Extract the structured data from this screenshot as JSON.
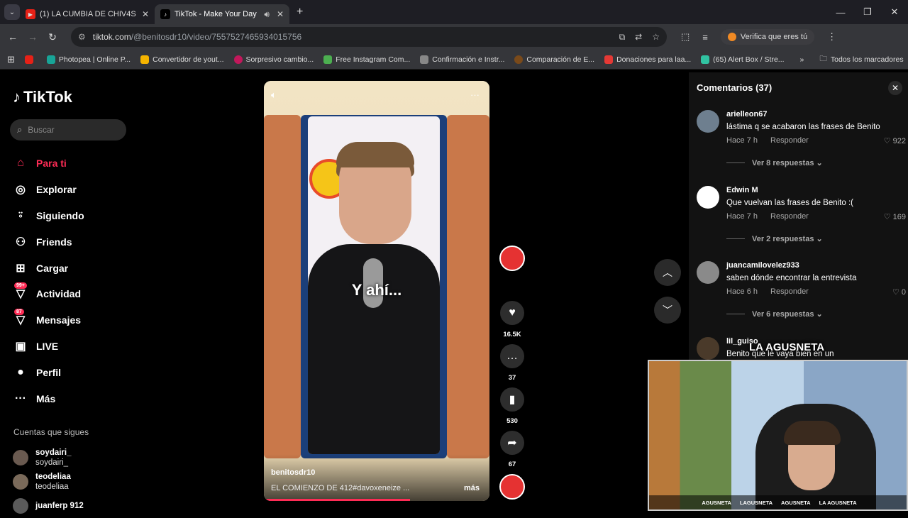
{
  "browser": {
    "tabs": [
      {
        "title": "(1) LA CUMBIA DE CHIV4S - Mi",
        "icon": "youtube-icon",
        "active": false
      },
      {
        "title": "TikTok - Make Your Day",
        "icon": "tiktok-icon",
        "active": true
      }
    ],
    "url_host": "tiktok.com",
    "url_path": "/@benitosdr10/video/7557527465934015756",
    "verify_label": "Verifica que eres tú",
    "bookmarks": [
      {
        "label": "",
        "color": "#e62117"
      },
      {
        "label": "Photopea | Online P...",
        "color": "#18a497"
      },
      {
        "label": "Convertidor de yout...",
        "color": "#f5b400"
      },
      {
        "label": "Sorpresivo cambio...",
        "color": "#c2185b"
      },
      {
        "label": "Free Instagram Com...",
        "color": "#4caf50"
      },
      {
        "label": "Confirmación e Instr...",
        "color": "#888888"
      },
      {
        "label": "Comparación de E...",
        "color": "#7a4a1a"
      },
      {
        "label": "Donaciones para laa...",
        "color": "#e53935"
      },
      {
        "label": "(65) Alert Box / Stre...",
        "color": "#31c3a2"
      }
    ],
    "all_bookmarks": "Todos los marcadores"
  },
  "sidebar": {
    "logo": "TikTok",
    "search_placeholder": "Buscar",
    "nav": [
      {
        "label": "Para ti",
        "icon": "home-icon",
        "active": true
      },
      {
        "label": "Explorar",
        "icon": "compass-icon"
      },
      {
        "label": "Siguiendo",
        "icon": "following-icon"
      },
      {
        "label": "Friends",
        "icon": "friends-icon"
      },
      {
        "label": "Cargar",
        "icon": "upload-icon"
      },
      {
        "label": "Actividad",
        "icon": "activity-icon",
        "badge": "99+"
      },
      {
        "label": "Mensajes",
        "icon": "messages-icon",
        "badge": "87"
      },
      {
        "label": "LIVE",
        "icon": "live-icon"
      },
      {
        "label": "Perfil",
        "icon": "profile-icon"
      },
      {
        "label": "Más",
        "icon": "more-icon"
      }
    ],
    "following_header": "Cuentas que sigues",
    "following": [
      {
        "name": "soydairi_",
        "handle": "soydairi_"
      },
      {
        "name": "teodeliaa",
        "handle": "teodeliaa"
      },
      {
        "name": "juanferp 912",
        "handle": ""
      }
    ]
  },
  "video": {
    "overlay_text": "Y ahí...",
    "username": "benitosdr10",
    "description": "EL COMIENZO DE 412#davoxeneize ...",
    "more": "más",
    "likes": "16.5K",
    "comments": "37",
    "saves": "530",
    "shares": "67"
  },
  "comments": {
    "header": "Comentarios (37)",
    "items": [
      {
        "user": "arielleon67",
        "text": "lástima q se acabaron las frases de Benito ",
        "time": "Hace 7 h",
        "reply": "Responder",
        "likes": "922",
        "replies": "Ver 8 respuestas"
      },
      {
        "user": "Edwin M",
        "text": "Que vuelvan las frases de Benito :(",
        "time": "Hace 7 h",
        "reply": "Responder",
        "likes": "169",
        "replies": "Ver 2 respuestas"
      },
      {
        "user": "juancamilovelez933",
        "text": "saben dónde encontrar la entrevista",
        "time": "Hace 6 h",
        "reply": "Responder",
        "likes": "0",
        "replies": "Ver 6 respuestas"
      },
      {
        "user": "lil_guiso",
        "text": "Benito          que le vaya bien en un",
        "time": "",
        "reply": "",
        "likes": "",
        "replies": ""
      }
    ]
  },
  "webcam": {
    "brand": "LA AGUSNETA",
    "socials": [
      "AGUSNETA",
      "LAGUSNETA",
      "AGUSNETA",
      "LA AGUSNETA"
    ]
  }
}
